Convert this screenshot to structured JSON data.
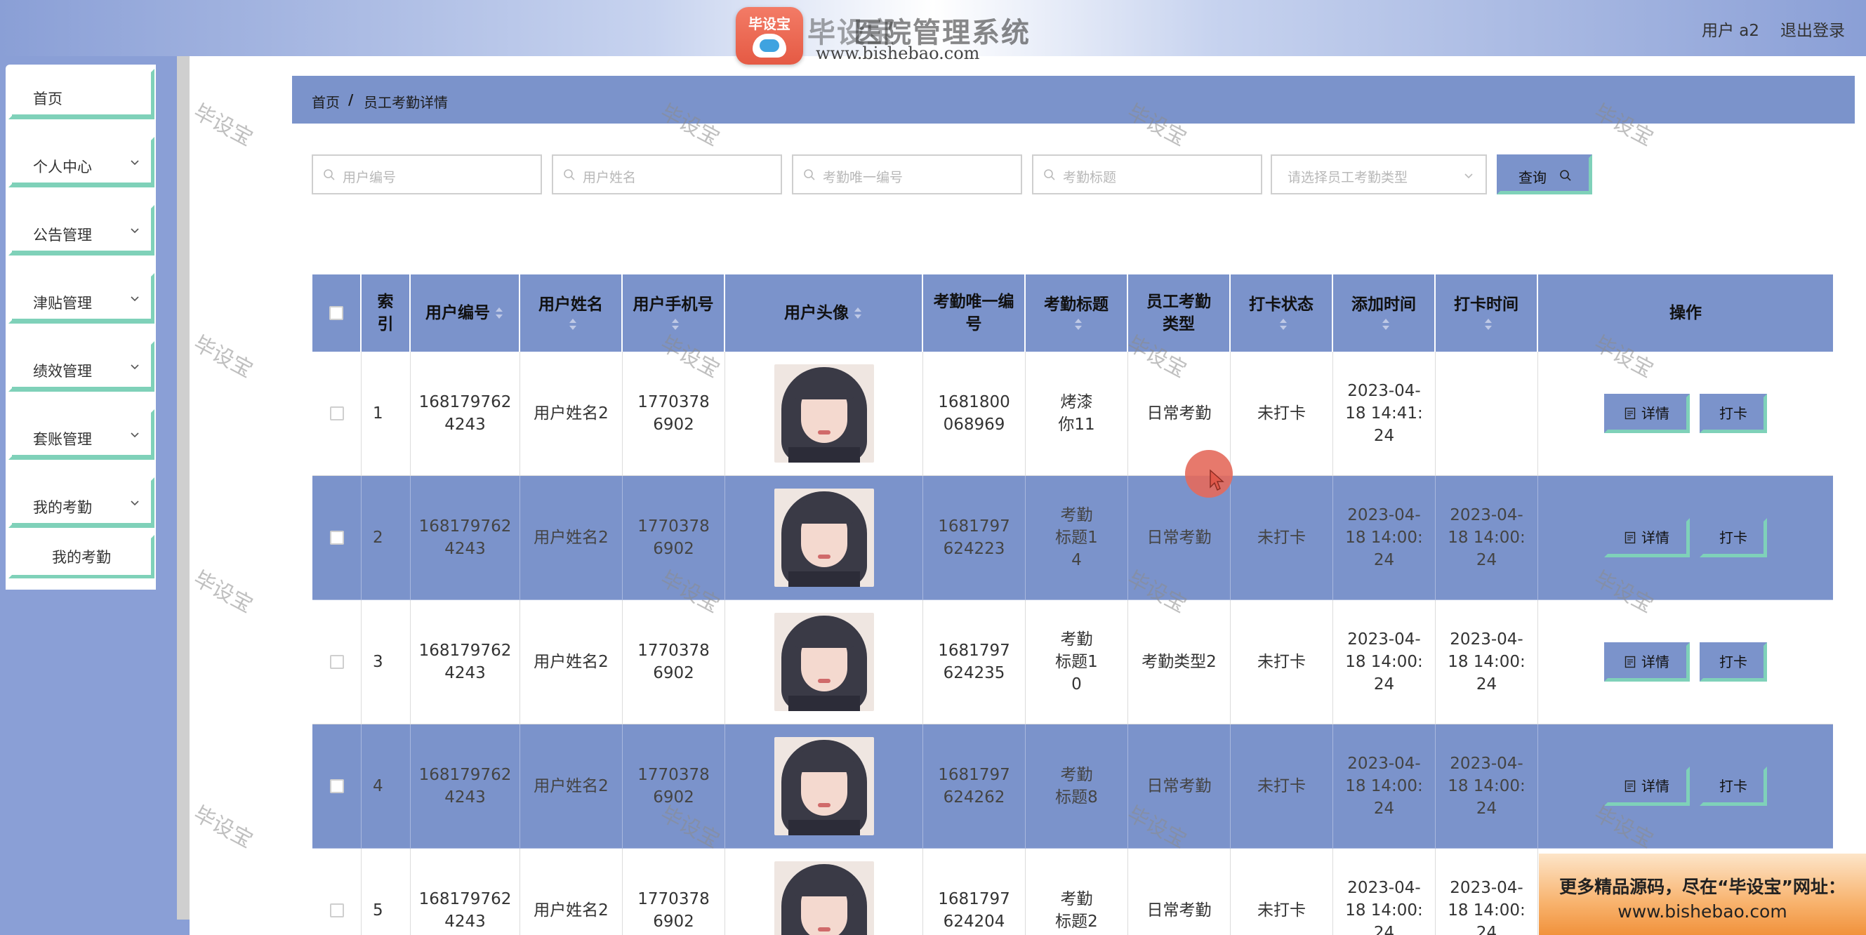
{
  "header": {
    "brand_badge": "毕设宝",
    "brand_name": "毕设宝",
    "system_title": "医院管理系统",
    "brand_url": "www.bishebao.com",
    "user_label": "用户 a2",
    "logout_label": "退出登录"
  },
  "sidebar": {
    "items": [
      {
        "label": "首页",
        "has_chevron": false
      },
      {
        "label": "个人中心",
        "has_chevron": true
      },
      {
        "label": "公告管理",
        "has_chevron": true
      },
      {
        "label": "津贴管理",
        "has_chevron": true
      },
      {
        "label": "绩效管理",
        "has_chevron": true
      },
      {
        "label": "套账管理",
        "has_chevron": true
      },
      {
        "label": "我的考勤",
        "has_chevron": true
      }
    ],
    "active_subitem": "我的考勤"
  },
  "breadcrumb": {
    "home": "首页",
    "separator": "/",
    "current": "员工考勤详情"
  },
  "search": {
    "user_no_placeholder": "用户编号",
    "user_name_placeholder": "用户姓名",
    "attendance_no_placeholder": "考勤唯一编号",
    "attendance_title_placeholder": "考勤标题",
    "type_select_placeholder": "请选择员工考勤类型",
    "query_label": "查询"
  },
  "table": {
    "headers": {
      "index": "索引",
      "user_no": "用户编号",
      "user_name": "用户姓名",
      "user_phone": "用户手机号",
      "avatar": "用户头像",
      "attendance_no": "考勤唯一编号",
      "attendance_title": "考勤标题",
      "attendance_type": "员工考勤类型",
      "checkin_status": "打卡状态",
      "added_time": "添加时间",
      "checkin_time": "打卡时间",
      "actions": "操作"
    },
    "detail_label": "详情",
    "checkin_label": "打卡",
    "rows": [
      {
        "index": "1",
        "user_no": "1681797624243",
        "user_name": "用户姓名2",
        "user_phone": "17703786902",
        "attendance_no": "1681800068969",
        "attendance_title": "烤漆你11",
        "attendance_type": "日常考勤",
        "checkin_status": "未打卡",
        "added_time": "2023-04-18 14:41:24",
        "checkin_time": ""
      },
      {
        "index": "2",
        "user_no": "1681797624243",
        "user_name": "用户姓名2",
        "user_phone": "17703786902",
        "attendance_no": "1681797624223",
        "attendance_title": "考勤标题14",
        "attendance_type": "日常考勤",
        "checkin_status": "未打卡",
        "added_time": "2023-04-18 14:00:24",
        "checkin_time": "2023-04-18 14:00:24"
      },
      {
        "index": "3",
        "user_no": "1681797624243",
        "user_name": "用户姓名2",
        "user_phone": "17703786902",
        "attendance_no": "1681797624235",
        "attendance_title": "考勤标题10",
        "attendance_type": "考勤类型2",
        "checkin_status": "未打卡",
        "added_time": "2023-04-18 14:00:24",
        "checkin_time": "2023-04-18 14:00:24"
      },
      {
        "index": "4",
        "user_no": "1681797624243",
        "user_name": "用户姓名2",
        "user_phone": "17703786902",
        "attendance_no": "1681797624262",
        "attendance_title": "考勤标题8",
        "attendance_type": "日常考勤",
        "checkin_status": "未打卡",
        "added_time": "2023-04-18 14:00:24",
        "checkin_time": "2023-04-18 14:00:24"
      },
      {
        "index": "5",
        "user_no": "1681797624243",
        "user_name": "用户姓名2",
        "user_phone": "17703786902",
        "attendance_no": "1681797624204",
        "attendance_title": "考勤标题2",
        "attendance_type": "日常考勤",
        "checkin_status": "未打卡",
        "added_time": "2023-04-18 14:00:24",
        "checkin_time": "2023-04-18 14:00:24"
      }
    ]
  },
  "watermark": "毕设宝",
  "ad": {
    "line1": "更多精品源码，尽在“毕设宝”网址：",
    "line2": "www.bishebao.com"
  },
  "colors": {
    "accent": "#7b93cb",
    "border_accent": "#7fd1b9",
    "sidebar_bg": "#8a9fd6"
  }
}
